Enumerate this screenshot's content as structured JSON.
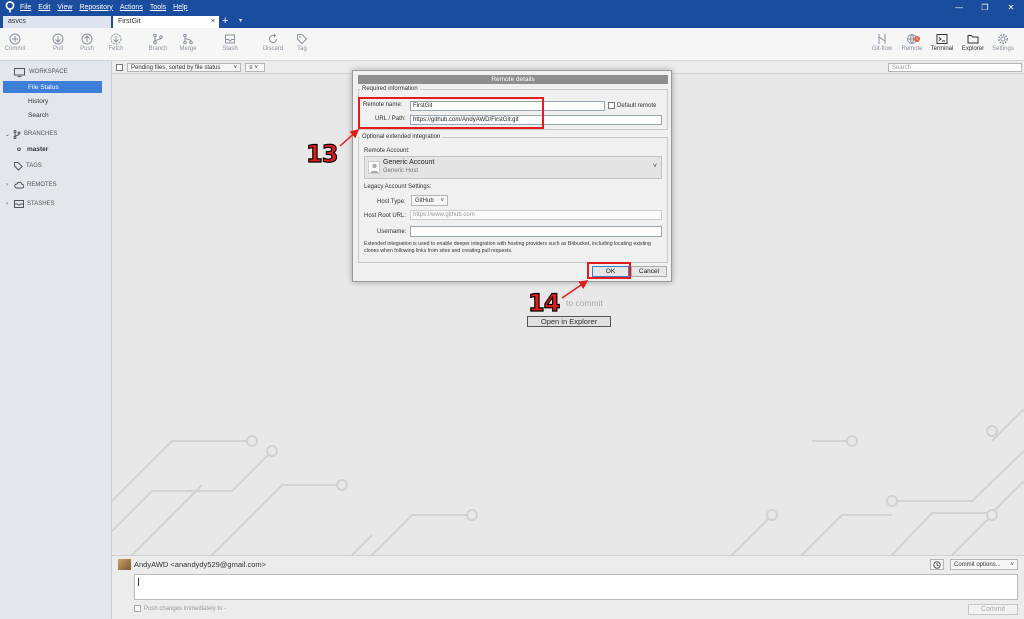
{
  "titlebar": {
    "menu": [
      "File",
      "Edit",
      "View",
      "Repository",
      "Actions",
      "Tools",
      "Help"
    ],
    "window_controls": [
      "minimize-icon",
      "restore-icon",
      "close-icon"
    ]
  },
  "tabs": {
    "items": [
      {
        "label": "asvcs",
        "active": false
      },
      {
        "label": "FirstGit",
        "active": true,
        "close": "×"
      }
    ],
    "add": "+",
    "more": "▾"
  },
  "toolbar": {
    "left": [
      {
        "label": "Commit",
        "icon": "plus-circle-icon"
      },
      {
        "label": "Pull",
        "icon": "arrow-down-circle-icon"
      },
      {
        "label": "Push",
        "icon": "arrow-up-circle-icon"
      },
      {
        "label": "Fetch",
        "icon": "arrow-down-icon"
      },
      {
        "label": "Branch",
        "icon": "branch-icon"
      },
      {
        "label": "Merge",
        "icon": "merge-icon"
      },
      {
        "label": "Stash",
        "icon": "stash-icon"
      },
      {
        "label": "Discard",
        "icon": "discard-icon"
      },
      {
        "label": "Tag",
        "icon": "tag-icon"
      }
    ],
    "right": [
      {
        "label": "Git-flow",
        "icon": "gitflow-icon"
      },
      {
        "label": "Remote",
        "icon": "globe-icon",
        "badge": "1"
      },
      {
        "label": "Terminal",
        "icon": "terminal-icon"
      },
      {
        "label": "Explorer",
        "icon": "folder-icon"
      },
      {
        "label": "Settings",
        "icon": "gear-icon"
      }
    ]
  },
  "sidebar": {
    "workspace": "WORKSPACE",
    "workspace_items": [
      "File Status",
      "History",
      "Search"
    ],
    "selected": "File Status",
    "branches": "BRANCHES",
    "branch_items": [
      "master"
    ],
    "tags": "TAGS",
    "remotes": "REMOTES",
    "stashes": "STASHES"
  },
  "filterbar": {
    "sort": "Pending files, sorted by file status",
    "view_icon": "list-icon",
    "search_placeholder": "Search"
  },
  "main": {
    "nothing_text": "to commit",
    "open_explorer": "Open in Explorer"
  },
  "commit": {
    "author": "AndyAWD <anandydy529@gmail.com>",
    "commit_options": "Commit options...",
    "push_immediately": "Push changes immediately to -",
    "commit_button": "Commit"
  },
  "dialog": {
    "title": "Remote details",
    "required_legend": "Required information",
    "remote_name_label": "Remote name:",
    "remote_name_value": "FirstGit",
    "default_remote": "Default remote",
    "url_label": "URL / Path:",
    "url_value": "https://github.com/AndyAWD/FirstGit.git",
    "optional_legend": "Optional extended integration",
    "remote_account_label": "Remote Account:",
    "account_name": "Generic Account",
    "account_host": "Generic Host",
    "legacy_label": "Legacy Account Settings:",
    "host_type_label": "Host Type:",
    "host_type_value": "GitHub",
    "host_root_label": "Host Root URL:",
    "host_root_placeholder": "https://www.github.com",
    "username_label": "Username:",
    "info_text": "Extended integration is used to enable deeper integration with hosting providers such as Bitbucket, including locating existing clones when following links from sites and creating pull requests.",
    "ok": "OK",
    "cancel": "Cancel"
  },
  "annotations": {
    "step1": "13",
    "step2": "14",
    "color": "#e31c1c"
  }
}
